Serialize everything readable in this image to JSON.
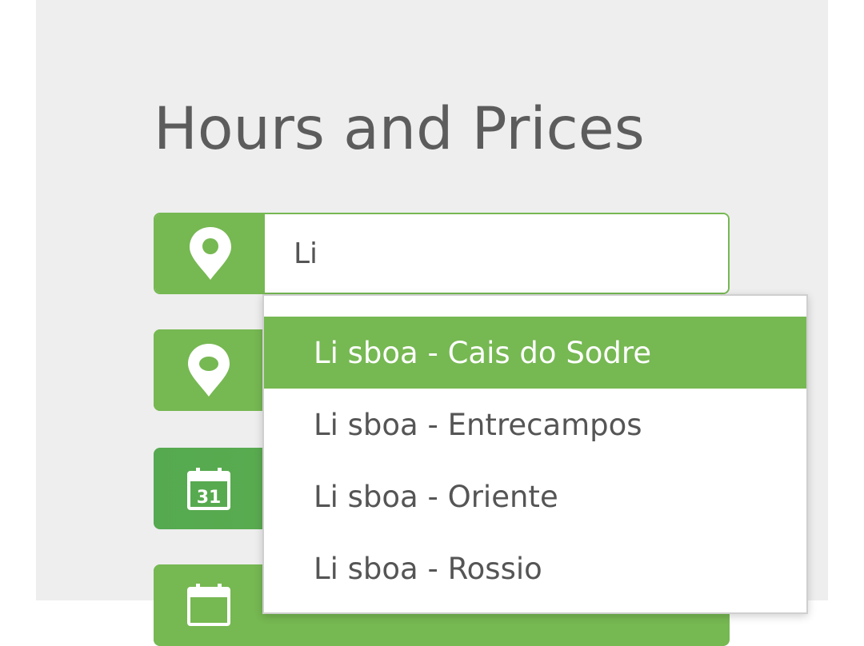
{
  "page": {
    "title": "Hours and Prices"
  },
  "colors": {
    "accent": "#76b852",
    "panel_bg": "#eeeeee",
    "text": "#5c5c5c"
  },
  "form": {
    "origin": {
      "icon": "map-pin-icon",
      "value": "Li"
    },
    "destination": {
      "icon": "map-pin-icon"
    },
    "date_out": {
      "icon": "calendar-icon",
      "day": "31"
    },
    "date_return": {
      "icon": "calendar-icon"
    }
  },
  "autocomplete": {
    "items": [
      {
        "label": "Li sboa - Cais do Sodre",
        "active": true
      },
      {
        "label": "Li sboa - Entrecampos",
        "active": false
      },
      {
        "label": "Li sboa - Oriente",
        "active": false
      },
      {
        "label": "Li sboa - Rossio",
        "active": false
      }
    ]
  }
}
